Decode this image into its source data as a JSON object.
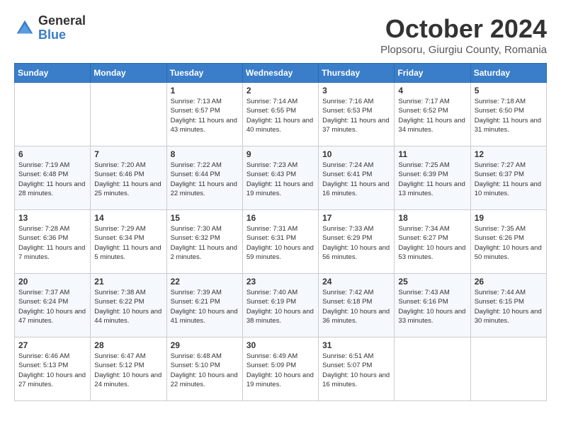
{
  "logo": {
    "general": "General",
    "blue": "Blue"
  },
  "title": "October 2024",
  "subtitle": "Plopsoru, Giurgiu County, Romania",
  "days_of_week": [
    "Sunday",
    "Monday",
    "Tuesday",
    "Wednesday",
    "Thursday",
    "Friday",
    "Saturday"
  ],
  "weeks": [
    [
      {
        "day": "",
        "sunrise": "",
        "sunset": "",
        "daylight": ""
      },
      {
        "day": "",
        "sunrise": "",
        "sunset": "",
        "daylight": ""
      },
      {
        "day": "1",
        "sunrise": "Sunrise: 7:13 AM",
        "sunset": "Sunset: 6:57 PM",
        "daylight": "Daylight: 11 hours and 43 minutes."
      },
      {
        "day": "2",
        "sunrise": "Sunrise: 7:14 AM",
        "sunset": "Sunset: 6:55 PM",
        "daylight": "Daylight: 11 hours and 40 minutes."
      },
      {
        "day": "3",
        "sunrise": "Sunrise: 7:16 AM",
        "sunset": "Sunset: 6:53 PM",
        "daylight": "Daylight: 11 hours and 37 minutes."
      },
      {
        "day": "4",
        "sunrise": "Sunrise: 7:17 AM",
        "sunset": "Sunset: 6:52 PM",
        "daylight": "Daylight: 11 hours and 34 minutes."
      },
      {
        "day": "5",
        "sunrise": "Sunrise: 7:18 AM",
        "sunset": "Sunset: 6:50 PM",
        "daylight": "Daylight: 11 hours and 31 minutes."
      }
    ],
    [
      {
        "day": "6",
        "sunrise": "Sunrise: 7:19 AM",
        "sunset": "Sunset: 6:48 PM",
        "daylight": "Daylight: 11 hours and 28 minutes."
      },
      {
        "day": "7",
        "sunrise": "Sunrise: 7:20 AM",
        "sunset": "Sunset: 6:46 PM",
        "daylight": "Daylight: 11 hours and 25 minutes."
      },
      {
        "day": "8",
        "sunrise": "Sunrise: 7:22 AM",
        "sunset": "Sunset: 6:44 PM",
        "daylight": "Daylight: 11 hours and 22 minutes."
      },
      {
        "day": "9",
        "sunrise": "Sunrise: 7:23 AM",
        "sunset": "Sunset: 6:43 PM",
        "daylight": "Daylight: 11 hours and 19 minutes."
      },
      {
        "day": "10",
        "sunrise": "Sunrise: 7:24 AM",
        "sunset": "Sunset: 6:41 PM",
        "daylight": "Daylight: 11 hours and 16 minutes."
      },
      {
        "day": "11",
        "sunrise": "Sunrise: 7:25 AM",
        "sunset": "Sunset: 6:39 PM",
        "daylight": "Daylight: 11 hours and 13 minutes."
      },
      {
        "day": "12",
        "sunrise": "Sunrise: 7:27 AM",
        "sunset": "Sunset: 6:37 PM",
        "daylight": "Daylight: 11 hours and 10 minutes."
      }
    ],
    [
      {
        "day": "13",
        "sunrise": "Sunrise: 7:28 AM",
        "sunset": "Sunset: 6:36 PM",
        "daylight": "Daylight: 11 hours and 7 minutes."
      },
      {
        "day": "14",
        "sunrise": "Sunrise: 7:29 AM",
        "sunset": "Sunset: 6:34 PM",
        "daylight": "Daylight: 11 hours and 5 minutes."
      },
      {
        "day": "15",
        "sunrise": "Sunrise: 7:30 AM",
        "sunset": "Sunset: 6:32 PM",
        "daylight": "Daylight: 11 hours and 2 minutes."
      },
      {
        "day": "16",
        "sunrise": "Sunrise: 7:31 AM",
        "sunset": "Sunset: 6:31 PM",
        "daylight": "Daylight: 10 hours and 59 minutes."
      },
      {
        "day": "17",
        "sunrise": "Sunrise: 7:33 AM",
        "sunset": "Sunset: 6:29 PM",
        "daylight": "Daylight: 10 hours and 56 minutes."
      },
      {
        "day": "18",
        "sunrise": "Sunrise: 7:34 AM",
        "sunset": "Sunset: 6:27 PM",
        "daylight": "Daylight: 10 hours and 53 minutes."
      },
      {
        "day": "19",
        "sunrise": "Sunrise: 7:35 AM",
        "sunset": "Sunset: 6:26 PM",
        "daylight": "Daylight: 10 hours and 50 minutes."
      }
    ],
    [
      {
        "day": "20",
        "sunrise": "Sunrise: 7:37 AM",
        "sunset": "Sunset: 6:24 PM",
        "daylight": "Daylight: 10 hours and 47 minutes."
      },
      {
        "day": "21",
        "sunrise": "Sunrise: 7:38 AM",
        "sunset": "Sunset: 6:22 PM",
        "daylight": "Daylight: 10 hours and 44 minutes."
      },
      {
        "day": "22",
        "sunrise": "Sunrise: 7:39 AM",
        "sunset": "Sunset: 6:21 PM",
        "daylight": "Daylight: 10 hours and 41 minutes."
      },
      {
        "day": "23",
        "sunrise": "Sunrise: 7:40 AM",
        "sunset": "Sunset: 6:19 PM",
        "daylight": "Daylight: 10 hours and 38 minutes."
      },
      {
        "day": "24",
        "sunrise": "Sunrise: 7:42 AM",
        "sunset": "Sunset: 6:18 PM",
        "daylight": "Daylight: 10 hours and 36 minutes."
      },
      {
        "day": "25",
        "sunrise": "Sunrise: 7:43 AM",
        "sunset": "Sunset: 6:16 PM",
        "daylight": "Daylight: 10 hours and 33 minutes."
      },
      {
        "day": "26",
        "sunrise": "Sunrise: 7:44 AM",
        "sunset": "Sunset: 6:15 PM",
        "daylight": "Daylight: 10 hours and 30 minutes."
      }
    ],
    [
      {
        "day": "27",
        "sunrise": "Sunrise: 6:46 AM",
        "sunset": "Sunset: 5:13 PM",
        "daylight": "Daylight: 10 hours and 27 minutes."
      },
      {
        "day": "28",
        "sunrise": "Sunrise: 6:47 AM",
        "sunset": "Sunset: 5:12 PM",
        "daylight": "Daylight: 10 hours and 24 minutes."
      },
      {
        "day": "29",
        "sunrise": "Sunrise: 6:48 AM",
        "sunset": "Sunset: 5:10 PM",
        "daylight": "Daylight: 10 hours and 22 minutes."
      },
      {
        "day": "30",
        "sunrise": "Sunrise: 6:49 AM",
        "sunset": "Sunset: 5:09 PM",
        "daylight": "Daylight: 10 hours and 19 minutes."
      },
      {
        "day": "31",
        "sunrise": "Sunrise: 6:51 AM",
        "sunset": "Sunset: 5:07 PM",
        "daylight": "Daylight: 10 hours and 16 minutes."
      },
      {
        "day": "",
        "sunrise": "",
        "sunset": "",
        "daylight": ""
      },
      {
        "day": "",
        "sunrise": "",
        "sunset": "",
        "daylight": ""
      }
    ]
  ]
}
